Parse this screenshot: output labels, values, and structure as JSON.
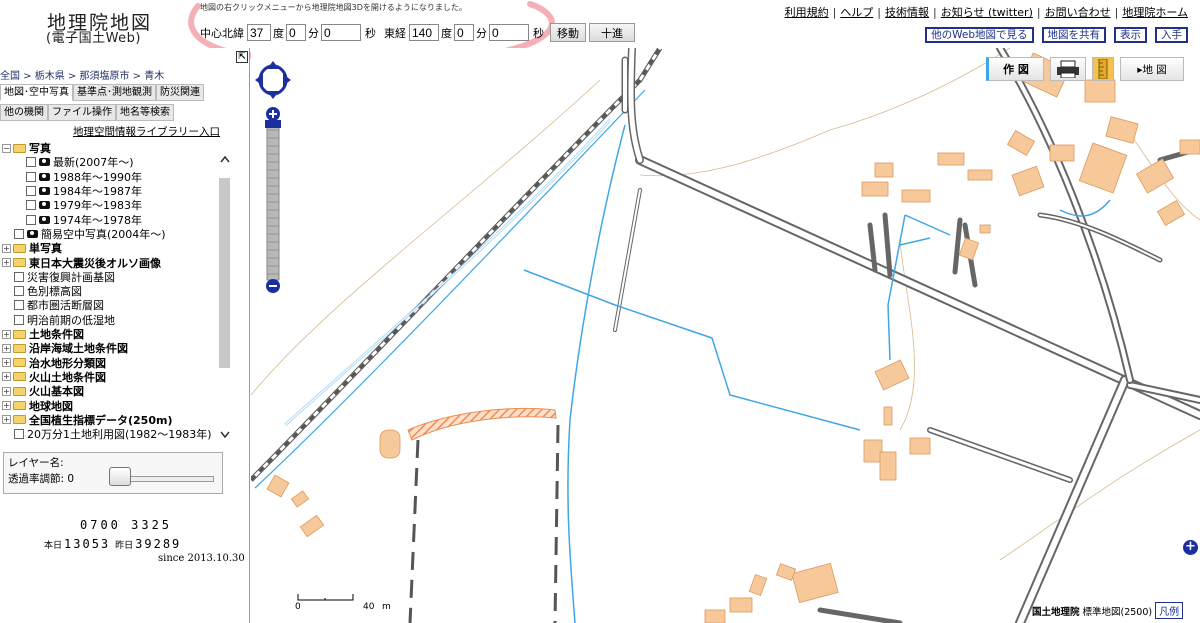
{
  "header": {
    "logo_title": "地理院地図",
    "logo_subtitle": "(電子国土Web)",
    "notice": "地図の右クリックメニューから地理院地図3Dを開けるようになりました。",
    "coords": {
      "lat_label": "中心北緯",
      "lat_deg": "37",
      "lat_min": "0",
      "lat_sec": "0",
      "lon_label": "東経",
      "lon_deg": "140",
      "lon_min": "0",
      "lon_sec": "0",
      "deg_unit": "度",
      "min_unit": "分",
      "sec_unit": "秒",
      "move_label": "移動",
      "crosshair_label": "十進"
    },
    "links": [
      "利用規約",
      "ヘルプ",
      "技術情報",
      "お知らせ (twitter)",
      "お問い合わせ",
      "地理院ホーム"
    ],
    "link_sep": "|",
    "buttons": [
      "他のWeb地図で見る",
      "地図を共有",
      "表示",
      "入手"
    ],
    "accent_color": "#203088"
  },
  "sidebar": {
    "breadcrumb": "全国 > 栃木県 > 那須塩原市 > 青木",
    "tabs_row1": [
      "地図･空中写真",
      "基準点･測地観測",
      "防災関連"
    ],
    "tabs_row2": [
      "他の機関",
      "ファイル操作",
      "地名等検索"
    ],
    "library_link": "地理空間情報ライブラリー入口",
    "tree": [
      {
        "type": "folder-open",
        "label": "写真",
        "bold": true,
        "indent": 0
      },
      {
        "type": "photo",
        "label": "最新(2007年～)",
        "indent": 2
      },
      {
        "type": "photo",
        "label": "1988年～1990年",
        "indent": 2
      },
      {
        "type": "photo",
        "label": "1984年～1987年",
        "indent": 2
      },
      {
        "type": "photo",
        "label": "1979年～1983年",
        "indent": 2
      },
      {
        "type": "photo",
        "label": "1974年～1978年",
        "indent": 2
      },
      {
        "type": "photo",
        "label": "簡易空中写真(2004年～)",
        "indent": 1
      },
      {
        "type": "folder",
        "label": "単写真",
        "bold": true,
        "indent": 0
      },
      {
        "type": "folder",
        "label": "東日本大震災後オルソ画像",
        "bold": true,
        "indent": 0
      },
      {
        "type": "item",
        "label": "災害復興計画基図",
        "indent": 1
      },
      {
        "type": "item",
        "label": "色別標高図",
        "indent": 1
      },
      {
        "type": "item",
        "label": "都市圏活断層図",
        "indent": 1
      },
      {
        "type": "item",
        "label": "明治前期の低湿地",
        "indent": 1
      },
      {
        "type": "folder",
        "label": "土地条件図",
        "bold": true,
        "indent": 0
      },
      {
        "type": "folder",
        "label": "沿岸海域土地条件図",
        "bold": true,
        "indent": 0
      },
      {
        "type": "folder",
        "label": "治水地形分類図",
        "bold": true,
        "indent": 0
      },
      {
        "type": "folder",
        "label": "火山土地条件図",
        "bold": true,
        "indent": 0
      },
      {
        "type": "folder",
        "label": "火山基本図",
        "bold": true,
        "indent": 0
      },
      {
        "type": "folder",
        "label": "地球地図",
        "bold": true,
        "indent": 0
      },
      {
        "type": "folder",
        "label": "全国植生指標データ(250m)",
        "bold": true,
        "indent": 0
      },
      {
        "type": "item",
        "label": "20万分1土地利用図(1982～1983年)",
        "indent": 1
      }
    ],
    "layer_name_label": "レイヤー名:",
    "opacity_label": "透過率調節: 0",
    "opacity_value": 0,
    "total_count": "0700 3325",
    "today_label": "本日",
    "today_count": "13053",
    "yesterday_label": "昨日",
    "yesterday_count": "39289",
    "since": "since 2013.10.30"
  },
  "map": {
    "draw_label": "作 図",
    "map_label": "▸地 図",
    "scale_zero": "0",
    "scale_max": "40",
    "scale_unit": "m",
    "attribution_org": "国土地理院",
    "attribution_map": "標準地図(2500)",
    "legend_button": "凡例",
    "colors": {
      "building": "#f7c99a",
      "building_edge": "#d99a5e",
      "road": "#666666",
      "water": "#3fa6e6",
      "hatch": "#f08b52"
    }
  }
}
